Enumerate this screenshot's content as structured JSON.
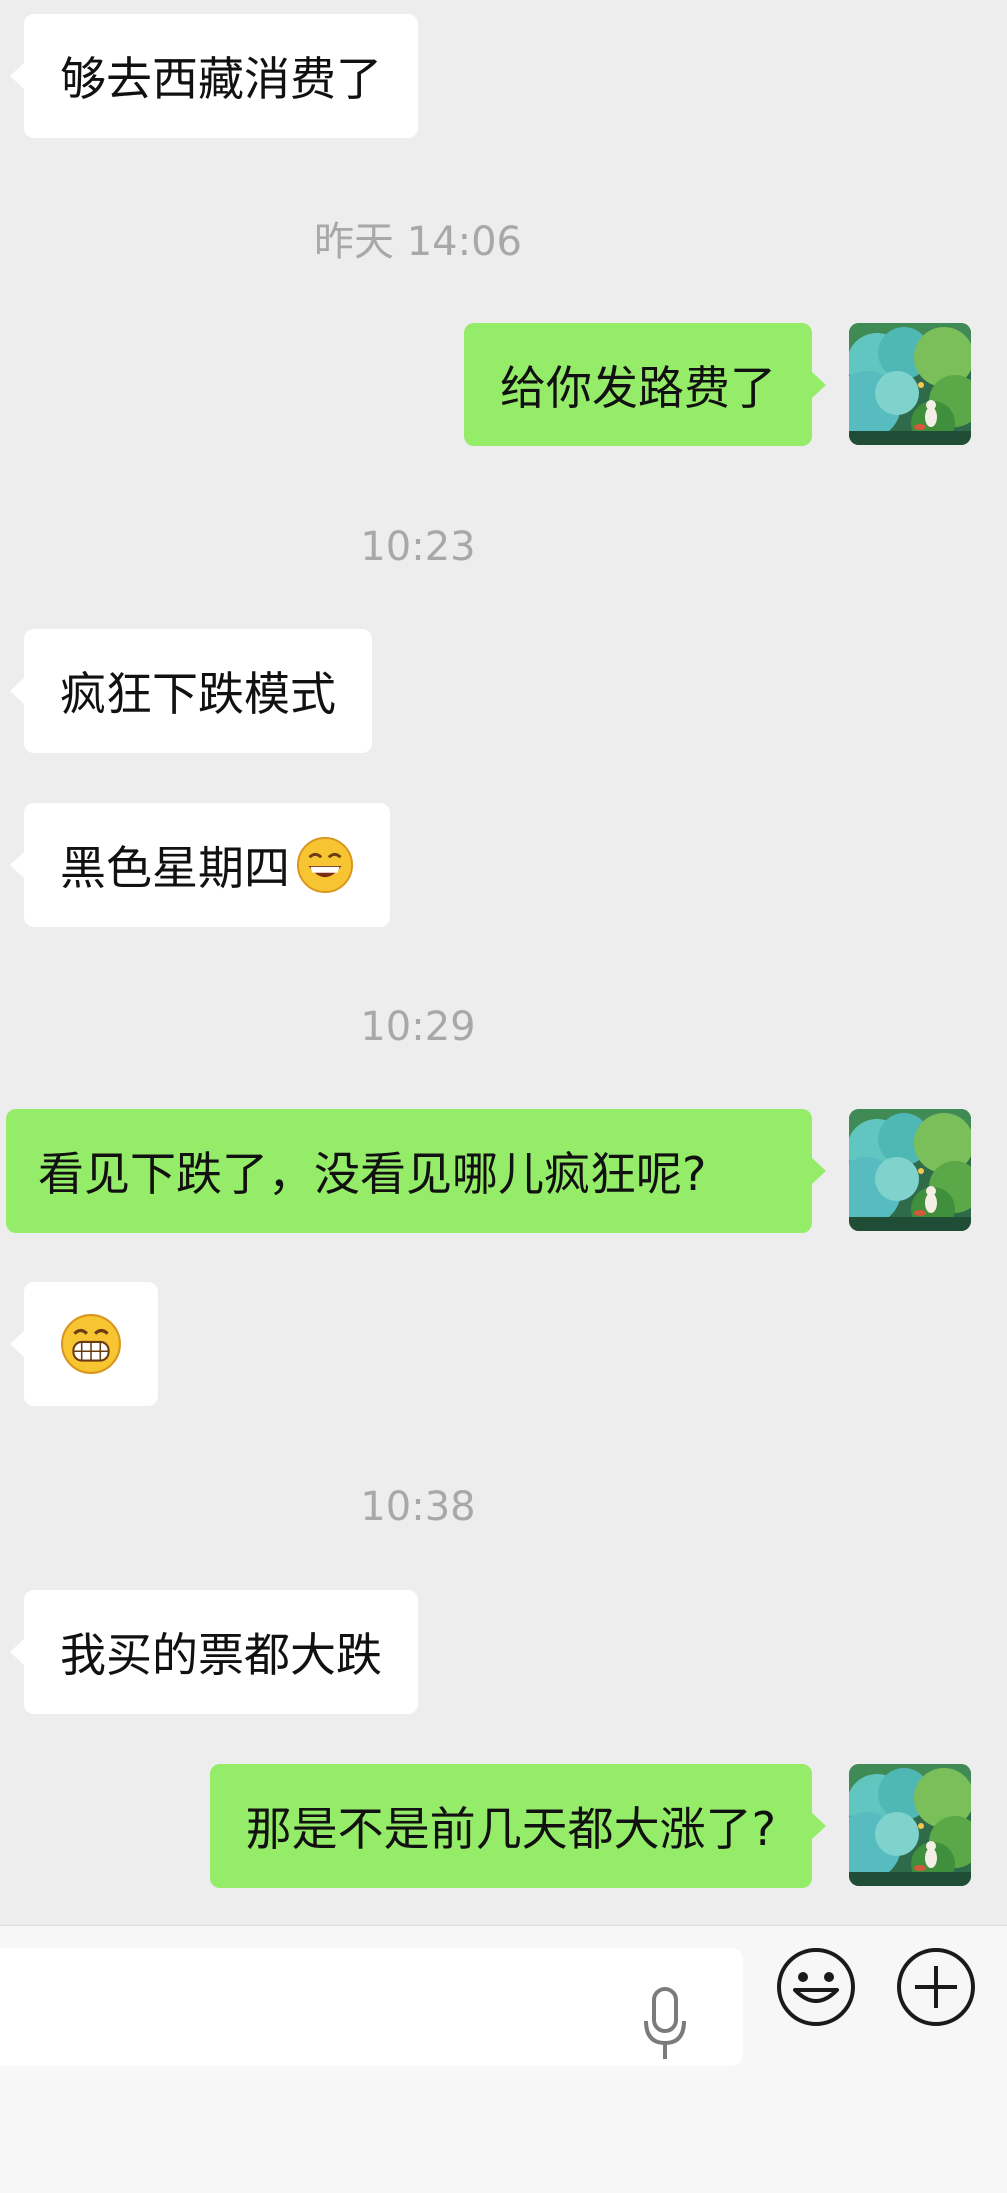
{
  "messages": {
    "m1": {
      "side": "in",
      "text": "够去西藏消费了"
    },
    "ts1": "昨天 14:06",
    "m2": {
      "side": "out",
      "text": "给你发路费了"
    },
    "ts2": "10:23",
    "m3": {
      "side": "in",
      "text": "疯狂下跌模式"
    },
    "m4": {
      "side": "in",
      "text": "黑色星期四",
      "emoji": "grinning-squint-emoji"
    },
    "ts3": "10:29",
    "m5": {
      "side": "out",
      "text": "看见下跌了，没看见哪儿疯狂呢?"
    },
    "m6": {
      "side": "in",
      "emoji": "grin-teeth-emoji"
    },
    "ts4": "10:38",
    "m7": {
      "side": "in",
      "text": "我买的票都大跌"
    },
    "m8": {
      "side": "out",
      "text": "那是不是前几天都大涨了?"
    }
  },
  "input_bar": {
    "placeholder": "",
    "icons": [
      "microphone-icon",
      "emoji-icon",
      "plus-icon"
    ]
  },
  "colors": {
    "background": "#ededed",
    "incoming_bubble": "#ffffff",
    "outgoing_bubble": "#95ec69",
    "timestamp": "#a8a8a8",
    "input_bar": "#f7f7f7"
  }
}
